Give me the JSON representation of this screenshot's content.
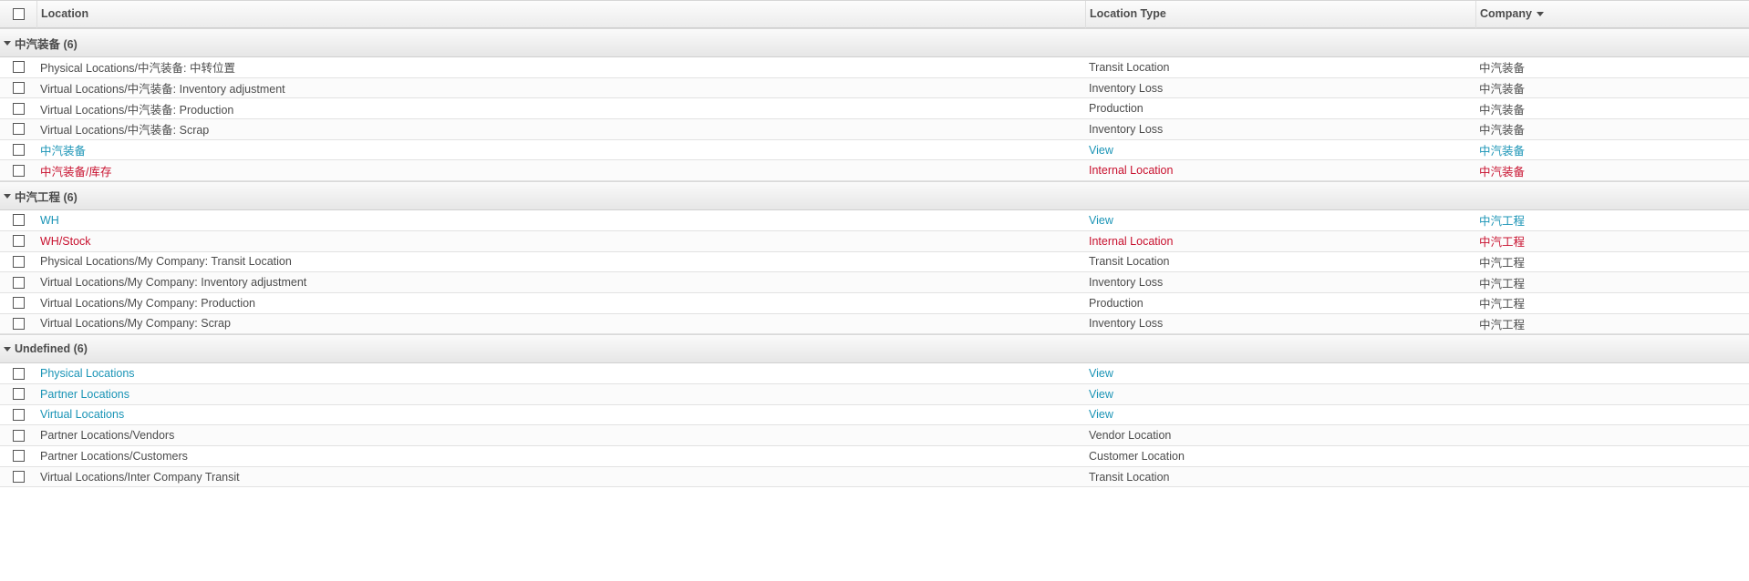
{
  "header": {
    "location": "Location",
    "location_type": "Location Type",
    "company": "Company"
  },
  "colors": {
    "view": "#1a94b6",
    "internal": "#c8102e",
    "normal": "#4c4c4c"
  },
  "groups": [
    {
      "label": "中汽装备 (6)",
      "rows": [
        {
          "location": "Physical Locations/中汽装备: 中转位置",
          "type": "Transit Location",
          "company": "中汽装备",
          "style": "normal"
        },
        {
          "location": "Virtual Locations/中汽装备: Inventory adjustment",
          "type": "Inventory Loss",
          "company": "中汽装备",
          "style": "normal"
        },
        {
          "location": "Virtual Locations/中汽装备: Production",
          "type": "Production",
          "company": "中汽装备",
          "style": "normal"
        },
        {
          "location": "Virtual Locations/中汽装备: Scrap",
          "type": "Inventory Loss",
          "company": "中汽装备",
          "style": "normal"
        },
        {
          "location": "中汽装备",
          "type": "View",
          "company": "中汽装备",
          "style": "view"
        },
        {
          "location": "中汽装备/库存",
          "type": "Internal Location",
          "company": "中汽装备",
          "style": "internal"
        }
      ]
    },
    {
      "label": "中汽工程 (6)",
      "rows": [
        {
          "location": "WH",
          "type": "View",
          "company": "中汽工程",
          "style": "view"
        },
        {
          "location": "WH/Stock",
          "type": "Internal Location",
          "company": "中汽工程",
          "style": "internal"
        },
        {
          "location": "Physical Locations/My Company: Transit Location",
          "type": "Transit Location",
          "company": "中汽工程",
          "style": "normal"
        },
        {
          "location": "Virtual Locations/My Company: Inventory adjustment",
          "type": "Inventory Loss",
          "company": "中汽工程",
          "style": "normal"
        },
        {
          "location": "Virtual Locations/My Company: Production",
          "type": "Production",
          "company": "中汽工程",
          "style": "normal"
        },
        {
          "location": "Virtual Locations/My Company: Scrap",
          "type": "Inventory Loss",
          "company": "中汽工程",
          "style": "normal"
        }
      ]
    },
    {
      "label": "Undefined (6)",
      "rows": [
        {
          "location": "Physical Locations",
          "type": "View",
          "company": "",
          "style": "view"
        },
        {
          "location": "Partner Locations",
          "type": "View",
          "company": "",
          "style": "view"
        },
        {
          "location": "Virtual Locations",
          "type": "View",
          "company": "",
          "style": "view"
        },
        {
          "location": "Partner Locations/Vendors",
          "type": "Vendor Location",
          "company": "",
          "style": "normal"
        },
        {
          "location": "Partner Locations/Customers",
          "type": "Customer Location",
          "company": "",
          "style": "normal"
        },
        {
          "location": "Virtual Locations/Inter Company Transit",
          "type": "Transit Location",
          "company": "",
          "style": "normal"
        }
      ]
    }
  ]
}
